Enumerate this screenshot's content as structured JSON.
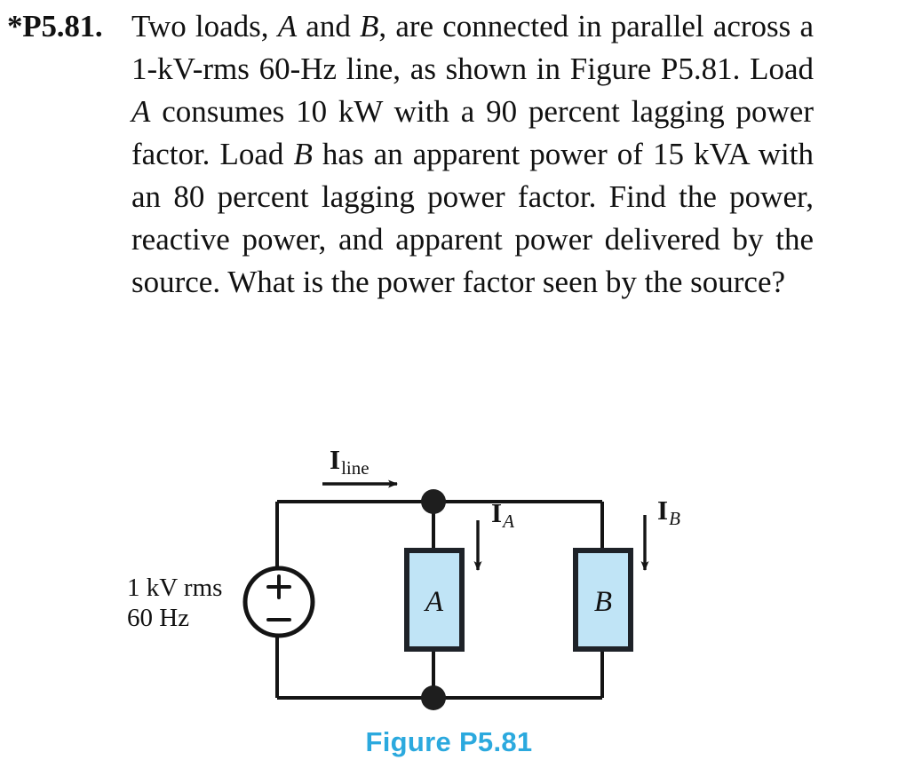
{
  "problem": {
    "number": "*P5.81.",
    "text_runs": [
      {
        "t": "Two loads, ",
        "i": false
      },
      {
        "t": "A",
        "i": true
      },
      {
        "t": " and ",
        "i": false
      },
      {
        "t": "B",
        "i": true
      },
      {
        "t": ", are connected in parallel across a 1-kV-rms 60-Hz line, as shown in Figure P5.81. Load ",
        "i": false
      },
      {
        "t": "A",
        "i": true
      },
      {
        "t": " consumes 10 kW with a 90 percent lagging power factor. Load ",
        "i": false
      },
      {
        "t": "B",
        "i": true
      },
      {
        "t": " has an apparent power of 15 kVA with an 80 percent lagging power factor. Find the power, reactive power, and apparent power delivered by the source. What is the power factor seen by the source?",
        "i": false
      }
    ],
    "plain_text": "Two loads, A and B, are connected in parallel across a 1-kV-rms 60-Hz line, as shown in Figure P5.81. Load A consumes 10 kW with a 90 percent lagging power factor. Load B has an apparent power of 15 kVA with an 80 percent lagging power factor. Find the power, reactive power, and apparent power delivered by the source. What is the power factor seen by the source?"
  },
  "figure": {
    "caption": "Figure P5.81",
    "caption_color": "#2BA9DE",
    "source": {
      "voltage_label": "1 kV rms",
      "frequency_label": "60 Hz",
      "plus_sign": "+",
      "minus_sign": "−"
    },
    "currents": {
      "line": {
        "base": "I",
        "subscript": "line",
        "subscript_italic": false,
        "direction": "right"
      },
      "a": {
        "base": "I",
        "subscript": "A",
        "subscript_italic": true,
        "direction": "down"
      },
      "b": {
        "base": "I",
        "subscript": "B",
        "subscript_italic": true,
        "direction": "down"
      }
    },
    "loads": [
      {
        "name": "load-a",
        "label": "A",
        "fill": "#C0E4F6",
        "stroke": "#1E2228"
      },
      {
        "name": "load-b",
        "label": "B",
        "fill": "#C0E4F6",
        "stroke": "#1E2228"
      }
    ],
    "wire_color": "#141414"
  }
}
